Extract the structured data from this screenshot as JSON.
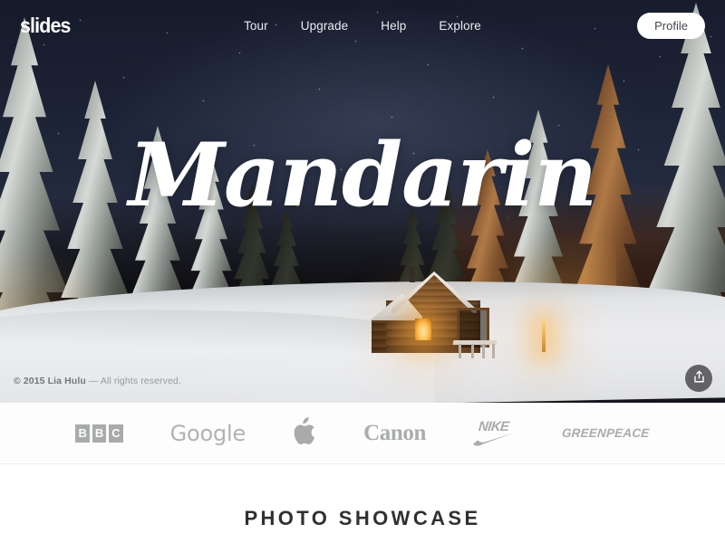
{
  "nav": {
    "logo": "slides",
    "links": [
      {
        "label": "Tour"
      },
      {
        "label": "Upgrade"
      },
      {
        "label": "Help"
      },
      {
        "label": "Explore"
      }
    ],
    "profile_label": "Profile"
  },
  "hero": {
    "title": "Mandarin",
    "copyright_bold": "© 2015 Lia Hulu",
    "copyright_rest": " — All rights reserved.",
    "scroll_icon": "chevron-down-icon",
    "share_icon": "share-upload-icon",
    "image_description": "snow covered pine forest at night with lit wooden cabin"
  },
  "logos_band": {
    "items": [
      {
        "name": "bbc",
        "label": "BBC",
        "letters": [
          "B",
          "B",
          "C"
        ]
      },
      {
        "name": "google",
        "label": "Google"
      },
      {
        "name": "apple",
        "label": "apple-logo-icon"
      },
      {
        "name": "canon",
        "label": "Canon"
      },
      {
        "name": "nike",
        "label": "NIKE"
      },
      {
        "name": "greenpeace",
        "label": "GREENPEACE"
      }
    ]
  },
  "showcase": {
    "heading": "PHOTO SHOWCASE"
  },
  "colors": {
    "logo_gray": "#a8aaac",
    "heading_dark": "#2f3033",
    "profile_bg": "#ffffff",
    "band_bg": "#fdfdfd",
    "sky_dark": "#161b2b"
  }
}
